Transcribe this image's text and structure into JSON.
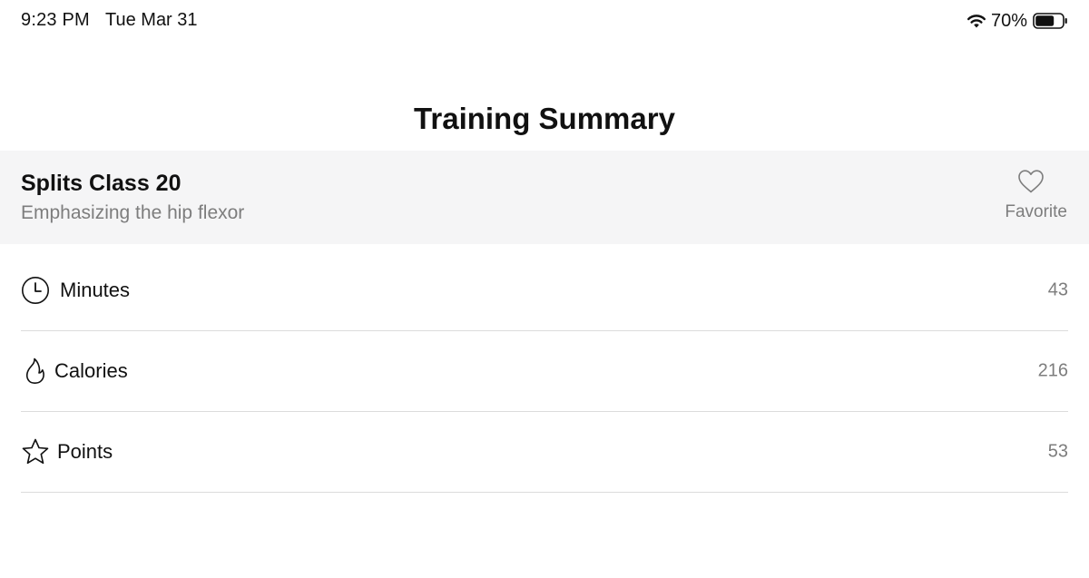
{
  "status_bar": {
    "time": "9:23 PM",
    "date": "Tue Mar 31",
    "battery_percent": "70%",
    "battery_level": 0.7,
    "icons": [
      "wifi-icon",
      "battery-icon"
    ]
  },
  "header": {
    "title": "Training Summary"
  },
  "class_card": {
    "name": "Splits Class 20",
    "subtitle": "Emphasizing the hip flexor",
    "favorite_label": "Favorite",
    "favorite_icon": "heart-icon"
  },
  "stats": [
    {
      "icon": "clock-icon",
      "label": "Minutes",
      "value": "43"
    },
    {
      "icon": "flame-icon",
      "label": "Calories",
      "value": "216"
    },
    {
      "icon": "star-icon",
      "label": "Points",
      "value": "53"
    }
  ],
  "colors": {
    "text_primary": "#111111",
    "text_secondary": "#7d7d7d",
    "card_background": "#f5f5f6",
    "divider": "#dcdcdc"
  }
}
